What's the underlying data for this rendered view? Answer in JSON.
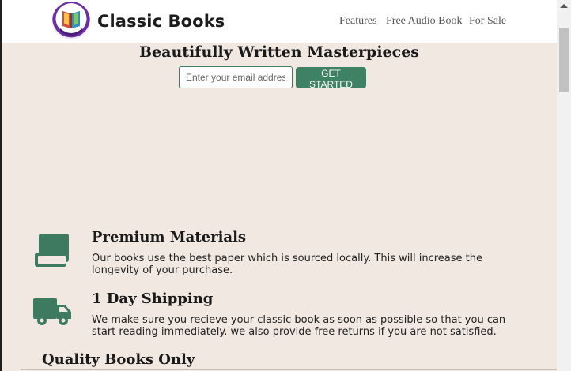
{
  "header": {
    "brand": "Classic Books",
    "nav": [
      "Features",
      "Free Audio Book",
      "For Sale"
    ]
  },
  "hero": {
    "title": "Beautifully Written Masterpieces",
    "email_placeholder": "Enter your email address",
    "cta_label": "GET STARTED"
  },
  "features": [
    {
      "icon": "book-icon",
      "title": "Premium Materials",
      "desc": "Our books use the best paper which is sourced locally. This will increase the longevity of your purchase."
    },
    {
      "icon": "truck-icon",
      "title": "1 Day Shipping",
      "desc": "We make sure you recieve your classic book as soon as possible so that you can start reading immediately. we also provide free returns if you are not satisfied."
    }
  ],
  "section": {
    "title": "Quality Books Only"
  },
  "colors": {
    "accent": "#3e8163",
    "background": "#f0e8e1",
    "icon": "#3e7a60"
  }
}
